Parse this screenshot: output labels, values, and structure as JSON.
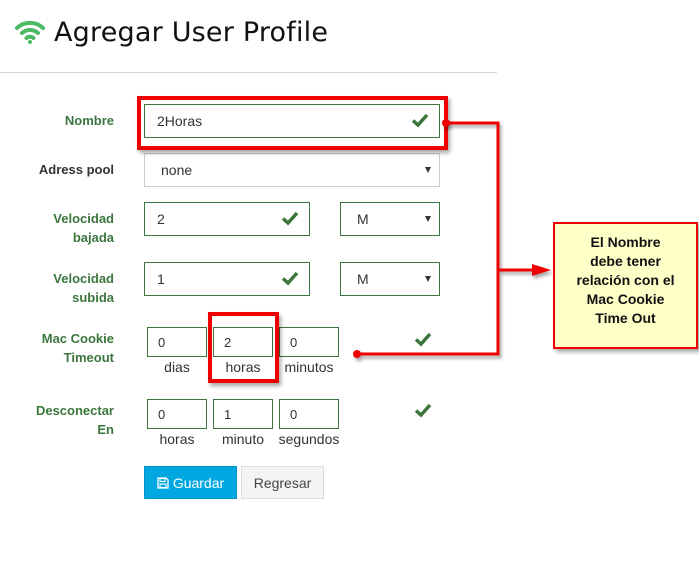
{
  "header": {
    "icon": "wifi-icon",
    "title": "Agregar User Profile",
    "accent_color": "#4cb963"
  },
  "form": {
    "nombre": {
      "label": "Nombre",
      "value": "2Horas",
      "valid": true
    },
    "address_pool": {
      "label": "Adress pool",
      "selected": "none"
    },
    "velocidad_bajada": {
      "label_line1": "Velocidad",
      "label_line2": "bajada",
      "value": "2",
      "unit": "M",
      "valid": true
    },
    "velocidad_subida": {
      "label_line1": "Velocidad",
      "label_line2": "subida",
      "value": "1",
      "unit": "M",
      "valid": true
    },
    "mac_cookie_timeout": {
      "label_line1": "Mac Cookie",
      "label_line2": "Timeout",
      "fields": [
        {
          "value": "0",
          "unit": "dias"
        },
        {
          "value": "2",
          "unit": "horas"
        },
        {
          "value": "0",
          "unit": "minutos"
        }
      ],
      "valid": true
    },
    "desconectar_en": {
      "label_line1": "Desconectar",
      "label_line2": "En",
      "fields": [
        {
          "value": "0",
          "unit": "horas"
        },
        {
          "value": "1",
          "unit": "minuto"
        },
        {
          "value": "0",
          "unit": "segundos"
        }
      ],
      "valid": true
    },
    "valid_color": "#3c763d"
  },
  "buttons": {
    "save_label": "Guardar",
    "save_icon": "floppy-disk-icon",
    "back_label": "Regresar",
    "primary_color": "#00a7e1"
  },
  "annotation": {
    "note_lines": [
      "El Nombre",
      "debe tener",
      "relación con el",
      "Mac Cookie",
      "Time Out"
    ],
    "highlight_color": "#ee0000",
    "note_background": "#ffffc8"
  }
}
